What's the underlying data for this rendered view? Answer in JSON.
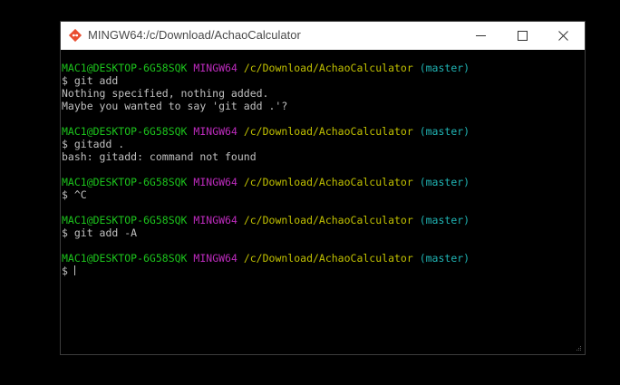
{
  "window": {
    "title": "MINGW64:/c/Download/AchaoCalculator"
  },
  "colors": {
    "user": "#1cc41c",
    "host": "#bd2bbd",
    "path": "#c1c100",
    "branch": "#20b5b5",
    "text": "#c0c0c0"
  },
  "terminal": {
    "blocks": [
      {
        "prompt": {
          "user": "MAC1@DESKTOP-6G58SQK",
          "host": "MINGW64",
          "path": "/c/Download/AchaoCalculator",
          "branch": "(master)"
        },
        "command": "$ git add",
        "output": [
          "Nothing specified, nothing added.",
          "Maybe you wanted to say 'git add .'?"
        ]
      },
      {
        "prompt": {
          "user": "MAC1@DESKTOP-6G58SQK",
          "host": "MINGW64",
          "path": "/c/Download/AchaoCalculator",
          "branch": "(master)"
        },
        "command": "$ gitadd .",
        "output": [
          "bash: gitadd: command not found"
        ]
      },
      {
        "prompt": {
          "user": "MAC1@DESKTOP-6G58SQK",
          "host": "MINGW64",
          "path": "/c/Download/AchaoCalculator",
          "branch": "(master)"
        },
        "command": "$ ^C",
        "output": []
      },
      {
        "prompt": {
          "user": "MAC1@DESKTOP-6G58SQK",
          "host": "MINGW64",
          "path": "/c/Download/AchaoCalculator",
          "branch": "(master)"
        },
        "command": "$ git add -A",
        "output": []
      },
      {
        "prompt": {
          "user": "MAC1@DESKTOP-6G58SQK",
          "host": "MINGW64",
          "path": "/c/Download/AchaoCalculator",
          "branch": "(master)"
        },
        "command": "$",
        "output": [],
        "active": true
      }
    ]
  }
}
